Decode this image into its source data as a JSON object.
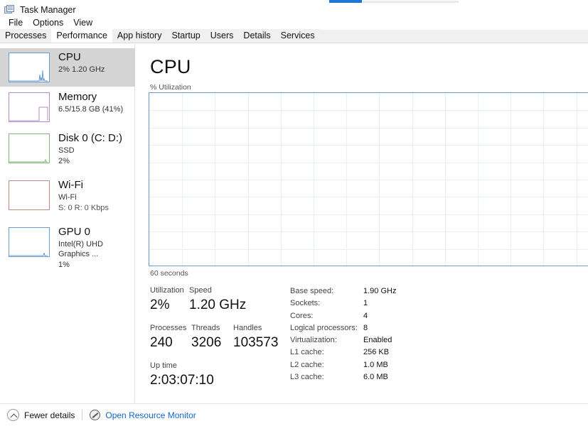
{
  "window": {
    "title": "Task Manager",
    "icon": "task-manager-icon"
  },
  "menu": {
    "items": [
      "File",
      "Options",
      "View"
    ]
  },
  "tabs": [
    {
      "label": "Processes",
      "selected": false
    },
    {
      "label": "Performance",
      "selected": true
    },
    {
      "label": "App history",
      "selected": false
    },
    {
      "label": "Startup",
      "selected": false
    },
    {
      "label": "Users",
      "selected": false
    },
    {
      "label": "Details",
      "selected": false
    },
    {
      "label": "Services",
      "selected": false
    }
  ],
  "sidebar": {
    "items": [
      {
        "title": "CPU",
        "line1": "2%  1.20 GHz",
        "line2": "",
        "color": "#6c9bd2",
        "selected": true
      },
      {
        "title": "Memory",
        "line1": "6.5/15.8 GB (41%)",
        "line2": "",
        "color": "#b38ec9",
        "selected": false
      },
      {
        "title": "Disk 0 (C: D:)",
        "line1": "SSD",
        "line2": "2%",
        "color": "#85b47c",
        "selected": false
      },
      {
        "title": "Wi-Fi",
        "line1": "Wi-Fi",
        "line2": "S: 0 R: 0 Kbps",
        "color": "#c08b7d",
        "selected": false
      },
      {
        "title": "GPU 0",
        "line1": "Intel(R) UHD Graphics ...",
        "line2": "1%",
        "color": "#6c9bd2",
        "selected": false
      }
    ]
  },
  "main": {
    "heading": "CPU",
    "graph_axis_label": "% Utilization",
    "graph_time_label": "60 seconds",
    "stats": {
      "utilization_label": "Utilization",
      "utilization_value": "2%",
      "speed_label": "Speed",
      "speed_value": "1.20 GHz",
      "processes_label": "Processes",
      "processes_value": "240",
      "threads_label": "Threads",
      "threads_value": "3206",
      "handles_label": "Handles",
      "handles_value": "103573",
      "uptime_label": "Up time",
      "uptime_value": "2:03:07:10"
    },
    "specs": [
      {
        "label": "Base speed:",
        "value": "1.90 GHz"
      },
      {
        "label": "Sockets:",
        "value": "1"
      },
      {
        "label": "Cores:",
        "value": "4"
      },
      {
        "label": "Logical processors:",
        "value": "8"
      },
      {
        "label": "Virtualization:",
        "value": "Enabled"
      },
      {
        "label": "L1 cache:",
        "value": "256 KB"
      },
      {
        "label": "L2 cache:",
        "value": "1.0 MB"
      },
      {
        "label": "L3 cache:",
        "value": "6.0 MB"
      }
    ]
  },
  "chart_data": {
    "type": "area",
    "title": "CPU % Utilization",
    "ylabel": "% Utilization",
    "xlabel": "60 seconds",
    "ylim": [
      0,
      100
    ],
    "xlim": [
      0,
      60
    ],
    "grid": true,
    "legend": "none",
    "accent_color": "#6c9bd2",
    "grid_color": "#e9eff6",
    "x": [],
    "values": [],
    "note": "Graph area is empty (no plotted utilization trace visible); only gridlines are drawn"
  },
  "statusbar": {
    "fewer_details": "Fewer details",
    "resource_monitor": "Open Resource Monitor",
    "chevron_icon": "chevron-up-icon",
    "monitor_icon": "resource-monitor-icon"
  },
  "colors": {
    "accent_blue": "#6c9bd2",
    "link_blue": "#1166cc",
    "selection_gray": "#d4d4d4",
    "tabstrip_gray": "#f0f0f0"
  }
}
